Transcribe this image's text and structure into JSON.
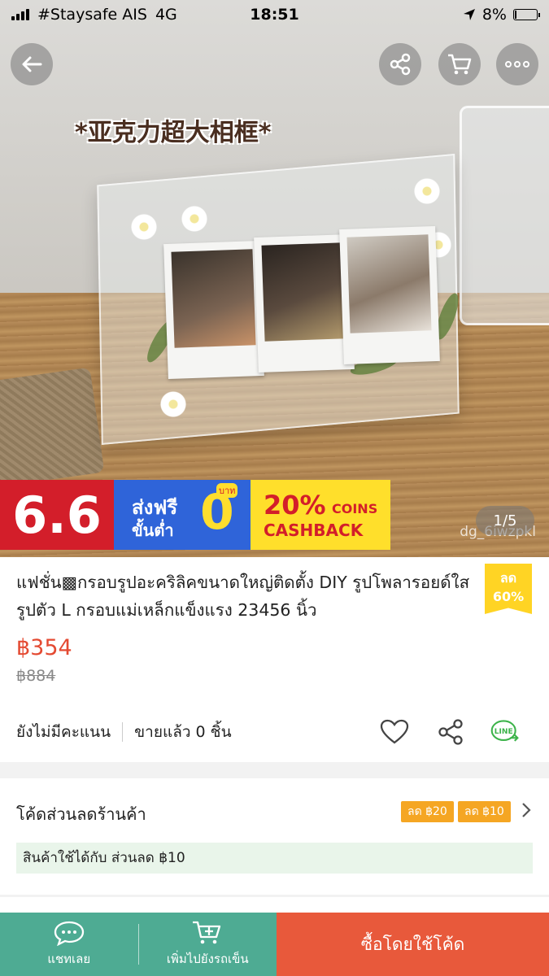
{
  "status_bar": {
    "carrier": "#Staysafe AIS",
    "network": "4G",
    "time": "18:51",
    "battery": "8%",
    "battery_level": 0.08
  },
  "hero": {
    "caption": "*亚克力超大相框*",
    "watermark": "dg_6iwzpkl",
    "pager": "1/5",
    "back_icon": "back-arrow-icon",
    "share_icon": "share-icon",
    "cart_icon": "cart-icon",
    "more_icon": "more-dots-icon"
  },
  "promo": {
    "sale_label": "6.6",
    "free_ship": "ส่งฟรี",
    "min_spend": "ขั้นต่ำ",
    "zero": "0",
    "baht": "บาท",
    "cashback_pct": "20%",
    "coins": "COINS",
    "cashback": "CASHBACK"
  },
  "product": {
    "title": "แฟชั่น▩กรอบรูปอะคริลิคขนาดใหญ่ติดตั้ง DIY รูปโพลารอยด์ใสรูปตัว L กรอบแม่เหล็กแข็งแรง 23456 นิ้ว",
    "discount_label": "ลด",
    "discount_pct": "60%",
    "price": "฿354",
    "old_price": "฿884",
    "rating": "ยังไม่มีคะแนน",
    "sold": "ขายแล้ว 0 ชิ้น"
  },
  "voucher": {
    "title": "โค้ดส่วนลดร้านค้า",
    "tags": [
      "ลด ฿20",
      "ลด ฿10"
    ],
    "note": "สินค้าใช้ได้กับ ส่วนลด ฿10"
  },
  "bottom_bar": {
    "chat": "แชทเลย",
    "add_cart": "เพิ่มไปยังรถเข็น",
    "buy": "ซื้อโดยใช้โค้ด"
  },
  "colors": {
    "price": "#e44a32",
    "accent_green": "#4eab93",
    "buy_orange": "#e8593b",
    "badge_yellow": "#ffd424",
    "tag_orange": "#f5a623"
  }
}
